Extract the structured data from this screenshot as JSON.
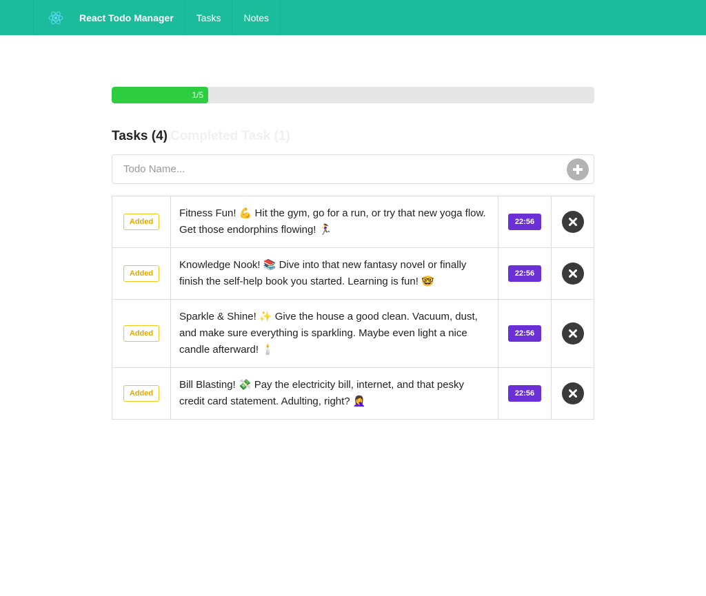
{
  "colors": {
    "navbar": "#1abc9c",
    "progress_fill": "#2ecc40",
    "time_badge": "#6b2fd6",
    "status_badge": "#f5c518"
  },
  "navbar": {
    "brand_icon": "react-atom-icon",
    "brand": "React Todo Manager",
    "links": [
      "Tasks",
      "Notes"
    ]
  },
  "progress": {
    "label": "1/5",
    "fraction": 0.2
  },
  "tabs": {
    "active": "Tasks (4)",
    "inactive": "Completed Task (1)"
  },
  "input": {
    "placeholder": "Todo Name...",
    "value": "",
    "add_icon": "plus-icon"
  },
  "todos": [
    {
      "status": "Added",
      "text": "Fitness Fun! 💪 Hit the gym, go for a run, or try that new yoga flow. Get those endorphins flowing! 🏃‍♀️",
      "time": "22:56",
      "delete_icon": "close-icon"
    },
    {
      "status": "Added",
      "text": "Knowledge Nook! 📚 Dive into that new fantasy novel or finally finish the self-help book you started. Learning is fun! 🤓",
      "time": "22:56",
      "delete_icon": "close-icon"
    },
    {
      "status": "Added",
      "text": "Sparkle & Shine! ✨ Give the house a good clean. Vacuum, dust, and make sure everything is sparkling. Maybe even light a nice candle afterward! 🕯️",
      "time": "22:56",
      "delete_icon": "close-icon"
    },
    {
      "status": "Added",
      "text": "Bill Blasting! 💸 Pay the electricity bill, internet, and that pesky credit card statement. Adulting, right? 🤦‍♀️",
      "time": "22:56",
      "delete_icon": "close-icon"
    }
  ]
}
